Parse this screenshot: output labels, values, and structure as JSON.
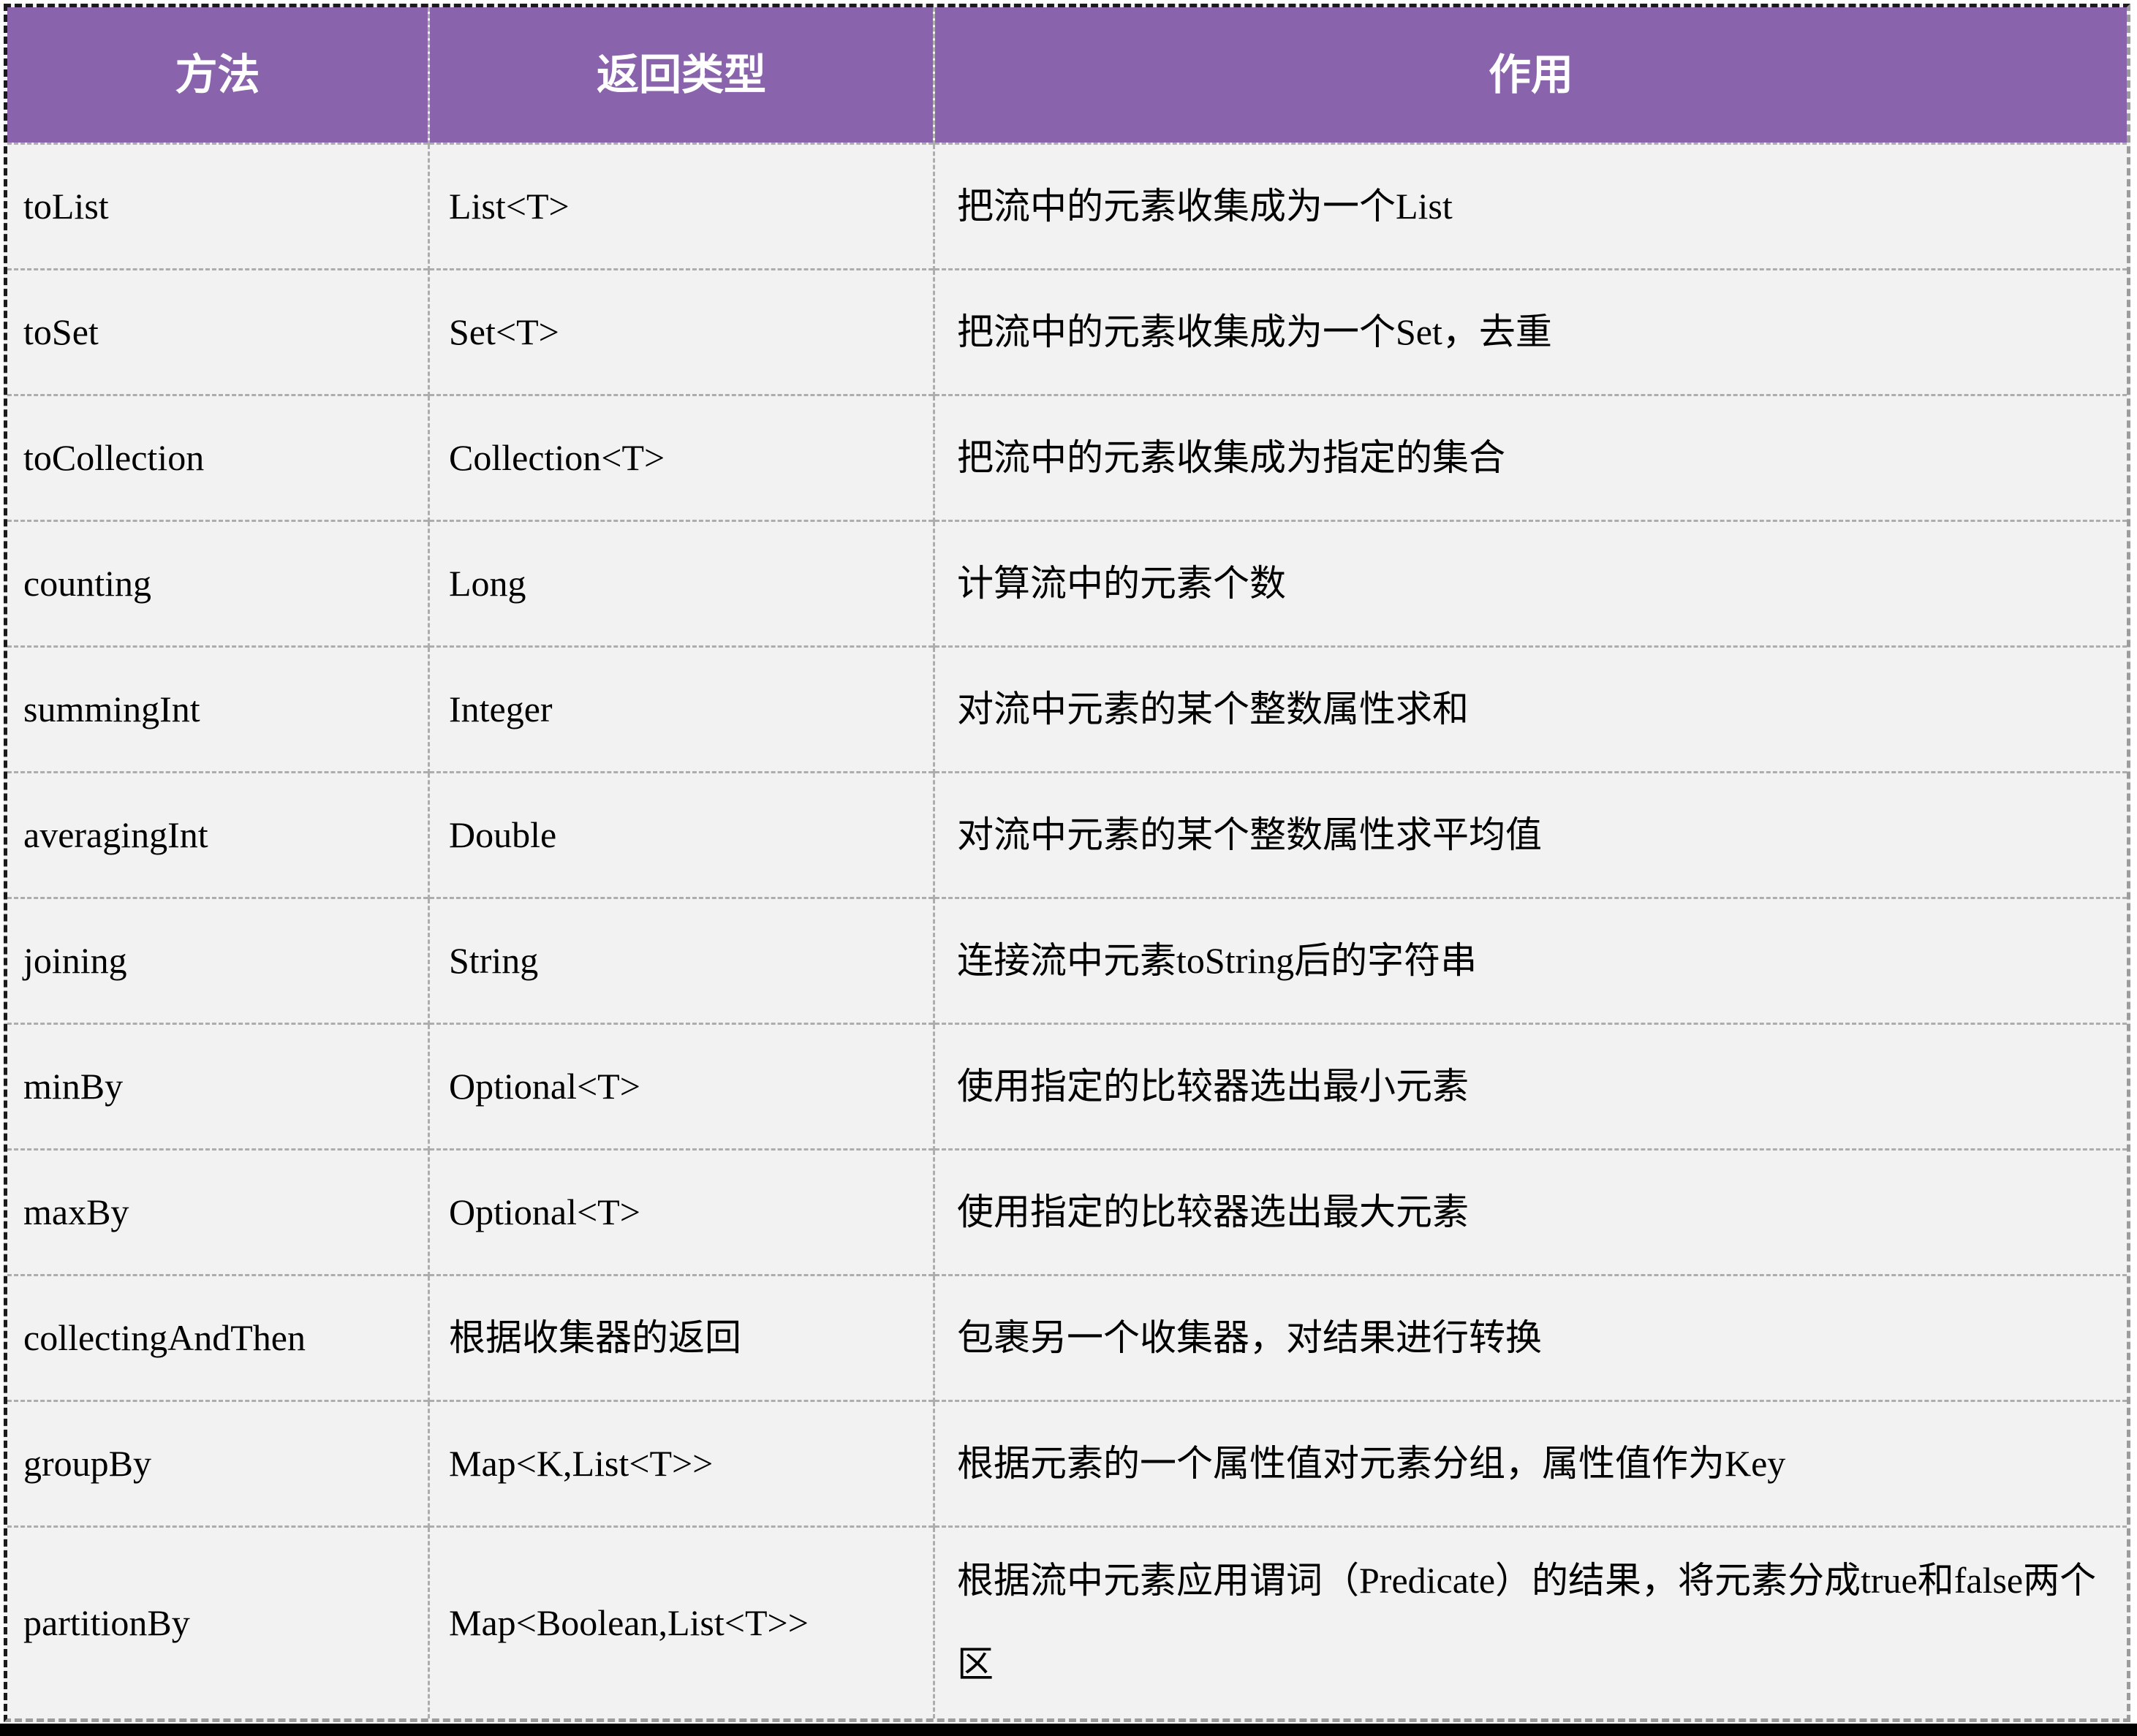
{
  "table": {
    "columns": [
      {
        "label": "方法"
      },
      {
        "label": "返回类型"
      },
      {
        "label": "作用"
      }
    ],
    "rows": [
      {
        "method": "toList",
        "return_type": "List<T>",
        "description": "把流中的元素收集成为一个List"
      },
      {
        "method": "toSet",
        "return_type": "Set<T>",
        "description": "把流中的元素收集成为一个Set，去重"
      },
      {
        "method": "toCollection",
        "return_type": "Collection<T>",
        "description": "把流中的元素收集成为指定的集合"
      },
      {
        "method": "counting",
        "return_type": "Long",
        "description": "计算流中的元素个数"
      },
      {
        "method": "summingInt",
        "return_type": "Integer",
        "description": "对流中元素的某个整数属性求和"
      },
      {
        "method": "averagingInt",
        "return_type": "Double",
        "description": "对流中元素的某个整数属性求平均值"
      },
      {
        "method": "joining",
        "return_type": "String",
        "description": "连接流中元素toString后的字符串"
      },
      {
        "method": "minBy",
        "return_type": "Optional<T>",
        "description": "使用指定的比较器选出最小元素"
      },
      {
        "method": "maxBy",
        "return_type": "Optional<T>",
        "description": "使用指定的比较器选出最大元素"
      },
      {
        "method": "collectingAndThen",
        "return_type": "根据收集器的返回",
        "description": "包裹另一个收集器，对结果进行转换"
      },
      {
        "method": "groupBy",
        "return_type": "Map<K,List<T>>",
        "description": "根据元素的一个属性值对元素分组，属性值作为Key"
      },
      {
        "method": "partitionBy",
        "return_type": "Map<Boolean,List<T>>",
        "description": "根据流中元素应用谓词（Predicate）的结果，将元素分成true和false两个区"
      }
    ],
    "colors": {
      "header_bg": "#8A63AD",
      "header_text": "#FFFFFF",
      "row_bg": "#F2F2F2",
      "grid_line": "#ADADAD",
      "outer_border_dark": "#1B1B1B",
      "outer_border_light": "#9C9C9C",
      "body_text": "#000000",
      "bottom_bar": "#000000"
    }
  }
}
